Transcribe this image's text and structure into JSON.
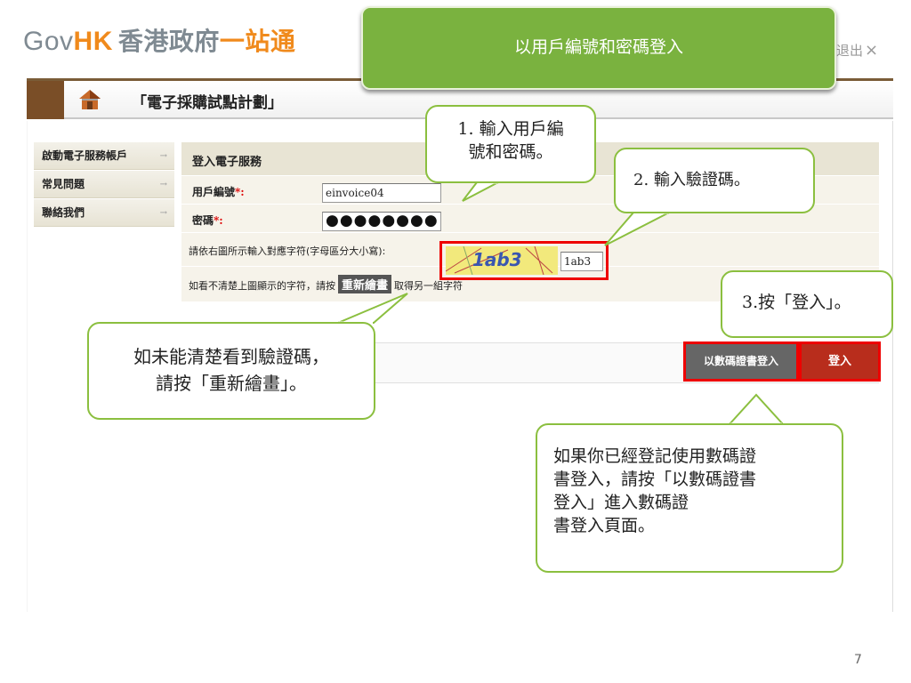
{
  "header": {
    "logo_gov": "Gov",
    "logo_hk": "HK",
    "logo_cn": "香港政府",
    "logo_one": "一站通",
    "logout": "退出",
    "logout_icon": "×"
  },
  "service_bar": {
    "icon": "house-icon",
    "title": "「電子採購試點計劃」"
  },
  "sidebar": {
    "items": [
      {
        "label": "啟動電子服務帳戶",
        "arrow": "→"
      },
      {
        "label": "常見問題",
        "arrow": "→"
      },
      {
        "label": "聯絡我們",
        "arrow": "→"
      }
    ]
  },
  "form": {
    "heading": "登入電子服務",
    "user_label": "用戶編號",
    "user_value": "einvoice04",
    "password_label": "密碼",
    "required_mark": "*:",
    "password_value": "●●●●●●●●",
    "captcha_label": "請依右圖所示輸入對應字符(字母區分大小寫):",
    "captcha_image_text": "1ab3",
    "captcha_value": "1ab3",
    "redraw_prefix": "如看不清楚上圖顯示的字符，請按",
    "redraw_button": "重新繪畫",
    "redraw_suffix": "取得另一組字符"
  },
  "buttons": {
    "cert_login": "以數碼證書登入",
    "login": "登入"
  },
  "callouts": {
    "title": "以用戶編號和密碼登入",
    "step1_line1": "1. 輸入用戶編",
    "step1_line2": "號和密碼。",
    "step2": "2. 輸入驗證碼。",
    "step3": "3.按「登入」。",
    "redraw_line1": "如未能清楚看到驗證碼，",
    "redraw_line2": "請按「重新繪畫」。",
    "cert_line1": "如果你已經登記使用數碼證",
    "cert_line2": "書登入，請按「以數碼證書",
    "cert_line3": "登入」進入數碼證",
    "cert_line4": "書登入頁面。"
  },
  "page_number": "7",
  "colors": {
    "accent_green": "#7ab23f",
    "callout_border": "#8bbf3f",
    "highlight_red": "#e00000",
    "login_button": "#b82d1c",
    "brand_orange": "#f08a1c"
  }
}
